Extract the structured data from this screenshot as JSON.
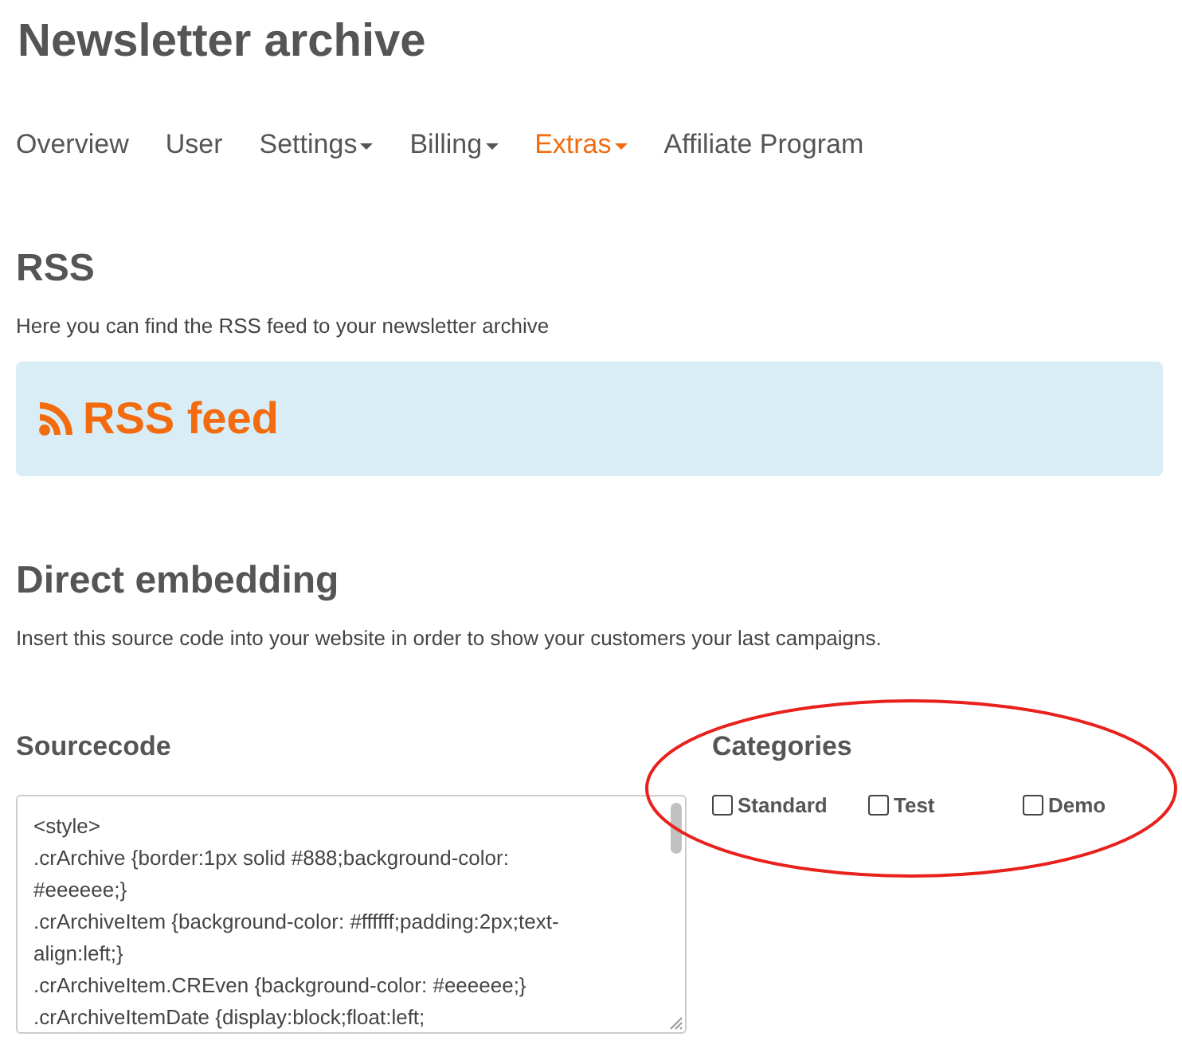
{
  "page_title": "Newsletter archive",
  "nav": [
    {
      "label": "Overview",
      "dropdown": false,
      "selected": false
    },
    {
      "label": "User",
      "dropdown": false,
      "selected": false
    },
    {
      "label": "Settings",
      "dropdown": true,
      "selected": false
    },
    {
      "label": "Billing",
      "dropdown": true,
      "selected": false
    },
    {
      "label": "Extras",
      "dropdown": true,
      "selected": true
    },
    {
      "label": "Affiliate Program",
      "dropdown": false,
      "selected": false
    }
  ],
  "rss": {
    "heading": "RSS",
    "description": "Here you can find the RSS feed to your newsletter archive",
    "link": "RSS feed"
  },
  "embedding": {
    "heading": "Direct embedding",
    "description": "Insert this source code into your website in order to show your customers your last campaigns.",
    "sourcecode": {
      "label": "Sourcecode",
      "lines": [
        "<style>",
        ".crArchive {border:1px solid #888;background-color: #eeeeee;}",
        ".crArchiveItem {background-color: #ffffff;padding:2px;text-align:left;}",
        ".crArchiveItem.CREven {background-color: #eeeeee;}",
        ".crArchiveItemDate {display:block;float:left;"
      ]
    },
    "categories": {
      "label": "Categories",
      "items": [
        {
          "label": "Standard",
          "checked": false
        },
        {
          "label": "Test",
          "checked": false
        },
        {
          "label": "Demo",
          "checked": false
        }
      ]
    }
  },
  "annotation": {
    "kind": "ellipse",
    "color": "#e8211d"
  }
}
